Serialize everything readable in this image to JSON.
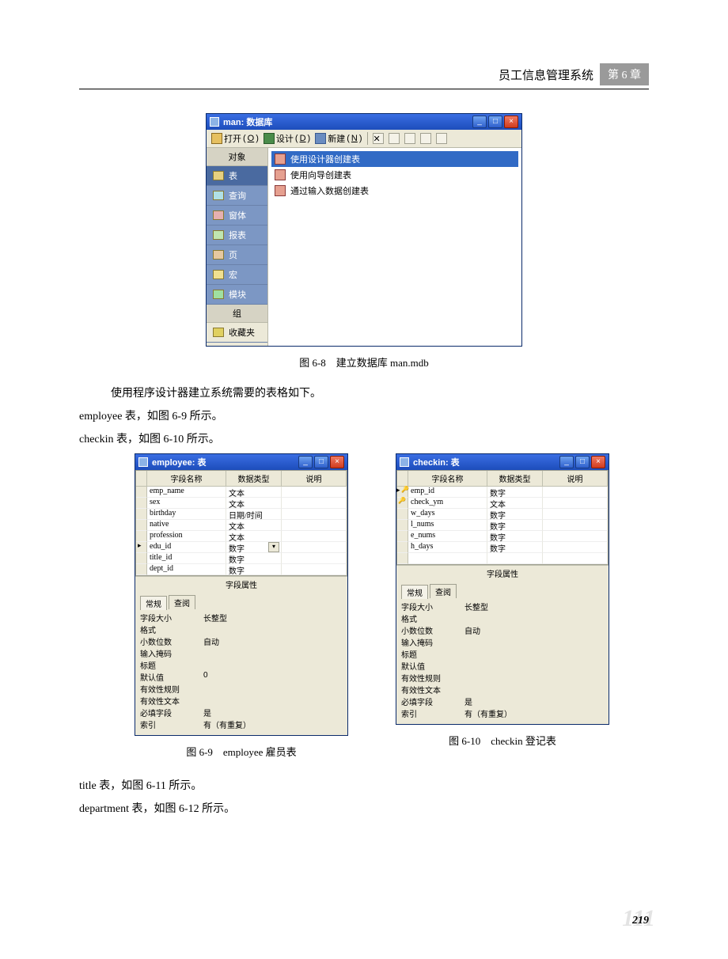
{
  "header": {
    "title": "员工信息管理系统",
    "chapter": "第 6 章"
  },
  "fig68": {
    "title": "man: 数据库",
    "toolbar": {
      "open": "打开",
      "open_key": "O",
      "design": "设计",
      "design_key": "D",
      "new": "新建",
      "new_key": "N"
    },
    "side_objects": "对象",
    "side": [
      "表",
      "查询",
      "窗体",
      "报表",
      "页",
      "宏",
      "模块"
    ],
    "side_group": "组",
    "side_fav": "收藏夹",
    "options": [
      "使用设计器创建表",
      "使用向导创建表",
      "通过输入数据创建表"
    ],
    "caption": "图 6-8　建立数据库 man.mdb"
  },
  "para1": "使用程序设计器建立系统需要的表格如下。",
  "para2": "employee 表，如图 6-9 所示。",
  "para3": "checkin 表，如图 6-10 所示。",
  "fig69": {
    "title": "employee: 表",
    "cols": [
      "字段名称",
      "数据类型",
      "说明"
    ],
    "rows": [
      {
        "n": "emp_name",
        "t": "文本"
      },
      {
        "n": "sex",
        "t": "文本"
      },
      {
        "n": "birthday",
        "t": "日期/时间"
      },
      {
        "n": "native",
        "t": "文本"
      },
      {
        "n": "profession",
        "t": "文本"
      },
      {
        "n": "edu_id",
        "t": "数字",
        "cur": true,
        "dd": true
      },
      {
        "n": "title_id",
        "t": "数字"
      },
      {
        "n": "dept_id",
        "t": "数字"
      }
    ],
    "props_title": "字段属性",
    "tabs": [
      "常规",
      "查阅"
    ],
    "props": [
      [
        "字段大小",
        "长整型"
      ],
      [
        "格式",
        ""
      ],
      [
        "小数位数",
        "自动"
      ],
      [
        "输入掩码",
        ""
      ],
      [
        "标题",
        ""
      ],
      [
        "默认值",
        "0"
      ],
      [
        "有效性规则",
        ""
      ],
      [
        "有效性文本",
        ""
      ],
      [
        "必填字段",
        "是"
      ],
      [
        "索引",
        "有（有重复）"
      ]
    ],
    "caption": "图 6-9　employee 雇员表"
  },
  "fig610": {
    "title": "checkin: 表",
    "cols": [
      "字段名称",
      "数据类型",
      "说明"
    ],
    "rows": [
      {
        "n": "emp_id",
        "t": "数字",
        "curk": true
      },
      {
        "n": "check_ym",
        "t": "文本",
        "key": true
      },
      {
        "n": "w_days",
        "t": "数字"
      },
      {
        "n": "l_nums",
        "t": "数字"
      },
      {
        "n": "e_nums",
        "t": "数字"
      },
      {
        "n": "h_days",
        "t": "数字"
      },
      {
        "n": "",
        "t": ""
      }
    ],
    "props_title": "字段属性",
    "tabs": [
      "常规",
      "查阅"
    ],
    "props": [
      [
        "字段大小",
        "长整型"
      ],
      [
        "格式",
        ""
      ],
      [
        "小数位数",
        "自动"
      ],
      [
        "输入掩码",
        ""
      ],
      [
        "标题",
        ""
      ],
      [
        "默认值",
        ""
      ],
      [
        "有效性规则",
        ""
      ],
      [
        "有效性文本",
        ""
      ],
      [
        "必填字段",
        "是"
      ],
      [
        "索引",
        "有（有重复）"
      ]
    ],
    "caption": "图 6-10　checkin 登记表"
  },
  "para4": "title 表，如图 6-11 所示。",
  "para5": "department 表，如图 6-12 所示。",
  "page_number": "219",
  "page_number_bg": "111"
}
